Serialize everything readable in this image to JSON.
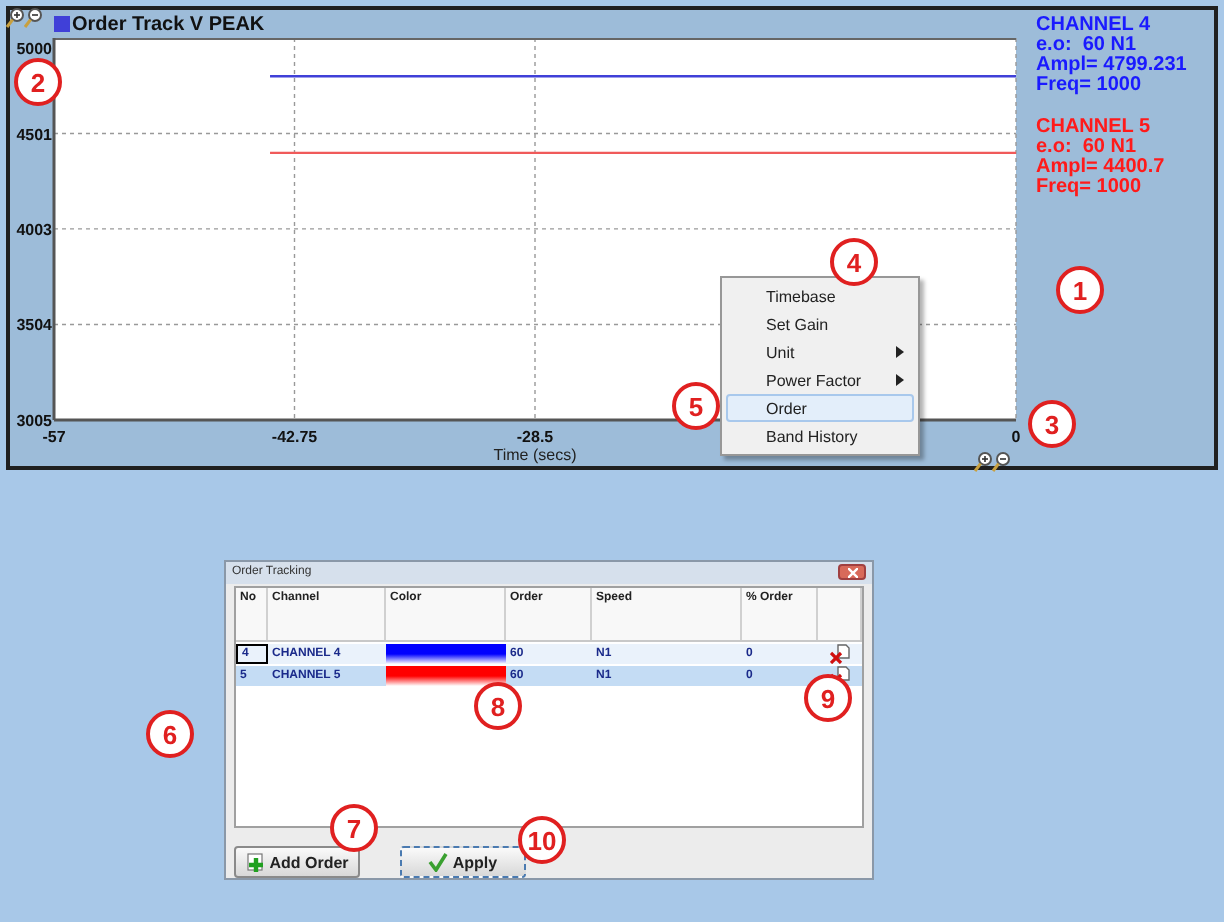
{
  "chart_panel": {
    "title": "Order Track V PEAK",
    "chart_data": {
      "type": "line",
      "xlabel": "Time (secs)",
      "x": [
        -44.2,
        0
      ],
      "xlim": [
        -57,
        0
      ],
      "ylim": [
        3005,
        5000
      ],
      "xticks": [
        -57,
        -42.75,
        -28.5,
        0
      ],
      "yticks": [
        3005,
        3504,
        4003,
        4501,
        5000
      ],
      "grid": true,
      "series": [
        {
          "name": "CHANNEL 4",
          "color": "#4040d8",
          "values": [
            4800,
            4800
          ]
        },
        {
          "name": "CHANNEL 5",
          "color": "#f05a5a",
          "values": [
            4400,
            4400
          ]
        }
      ]
    },
    "legend": [
      {
        "color": "#1a1aff",
        "lines": [
          "e.o:  60 N1",
          "Ampl= 4799.231",
          "Freq= 1000"
        ]
      },
      {
        "color": "#ff1a1a",
        "lines": [
          "e.o:  60 N1",
          "Ampl= 4400.7",
          "Freq= 1000"
        ]
      }
    ]
  },
  "context_menu": {
    "items": [
      {
        "label": "Timebase",
        "submenu": false,
        "selected": false
      },
      {
        "label": "Set Gain",
        "submenu": false,
        "selected": false
      },
      {
        "label": "Unit",
        "submenu": true,
        "selected": false
      },
      {
        "label": "Power Factor",
        "submenu": true,
        "selected": false
      },
      {
        "label": "Order",
        "submenu": false,
        "selected": true
      },
      {
        "label": "Band History",
        "submenu": false,
        "selected": false
      }
    ]
  },
  "dialog": {
    "title": "Order Tracking",
    "columns": [
      "No",
      "Channel",
      "Color",
      "Order",
      "Speed",
      "% Order"
    ],
    "rows": [
      {
        "no": "4",
        "channel": "CHANNEL 4",
        "color": "#0000ff",
        "order": "60",
        "speed": "N1",
        "percent_order": "0",
        "selected": false,
        "focused": true
      },
      {
        "no": "5",
        "channel": "CHANNEL 5",
        "color": "#ff0000",
        "order": "60",
        "speed": "N1",
        "percent_order": "0",
        "selected": true,
        "focused": false
      }
    ],
    "buttons": [
      {
        "label": "Add Order",
        "kind": "add",
        "focused": false
      },
      {
        "label": "Apply",
        "kind": "apply",
        "focused": true
      }
    ]
  },
  "callouts": [
    "1",
    "2",
    "3",
    "4",
    "5",
    "6",
    "7",
    "8",
    "9",
    "10"
  ]
}
